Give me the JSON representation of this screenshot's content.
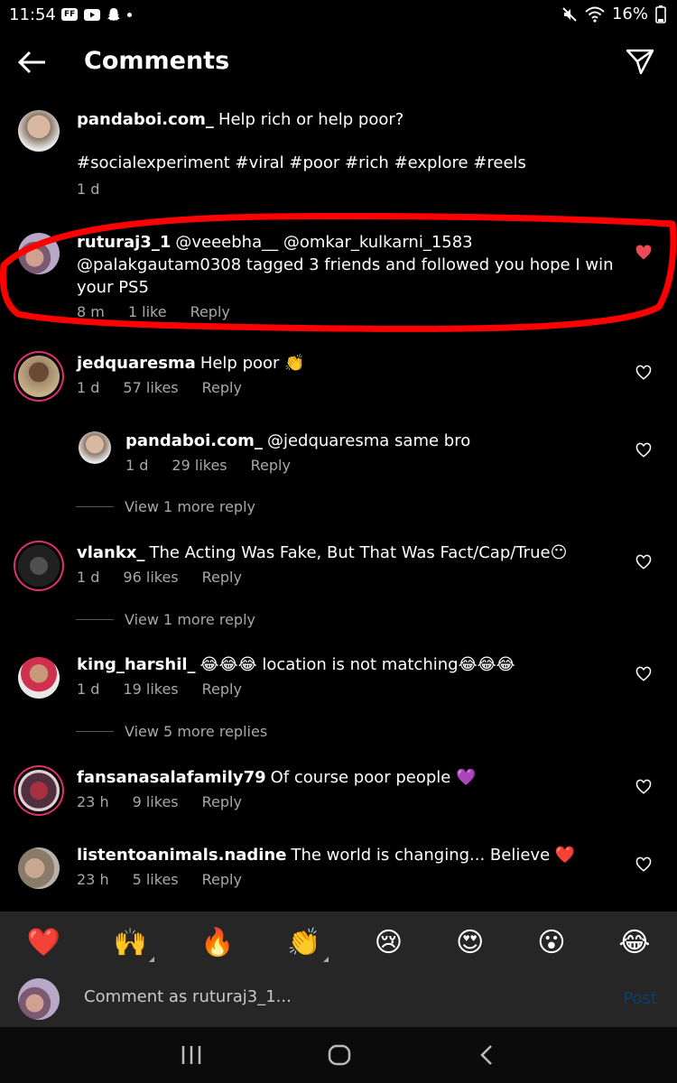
{
  "status_bar": {
    "time": "11:54",
    "battery": "16%",
    "carrier_badge": "FF"
  },
  "header": {
    "title": "Comments"
  },
  "post": {
    "username": "pandaboi.com_",
    "text": "Help rich or help poor?",
    "hashtags": "#socialexperiment #viral #poor #rich #explore #reels",
    "time": "1 d"
  },
  "comments": [
    {
      "username": "ruturaj3_1",
      "text": "@veeebha__ @omkar_kulkarni_1583 @palakgautam0308 tagged 3 friends and followed you hope I win your PS5",
      "time": "8 m",
      "likes": "1 like",
      "reply": "Reply",
      "liked": true
    },
    {
      "username": "jedquaresma",
      "text": "Help poor 👏",
      "time": "1 d",
      "likes": "57 likes",
      "reply": "Reply"
    },
    {
      "username": "pandaboi.com_",
      "text": "@jedquaresma same bro",
      "time": "1 d",
      "likes": "29 likes",
      "reply": "Reply"
    },
    {
      "username": "vlankx_",
      "text": "The Acting Was Fake, But That Was Fact/Cap/True😶",
      "time": "1 d",
      "likes": "96 likes",
      "reply": "Reply"
    },
    {
      "username": "king_harshil_",
      "text": "😂😂😂 location is not matching😂😂😂",
      "time": "1 d",
      "likes": "19 likes",
      "reply": "Reply"
    },
    {
      "username": "fansanasalafamily79",
      "text": "Of course poor people 💜",
      "time": "23 h",
      "likes": "9 likes",
      "reply": "Reply"
    },
    {
      "username": "listentoanimals.nadine",
      "text": "The world is changing... Believe ❤️",
      "time": "23 h",
      "likes": "5 likes",
      "reply": "Reply"
    }
  ],
  "view_more": [
    "View 1 more reply",
    "View 1 more reply",
    "View 5 more replies"
  ],
  "emoji_bar": [
    "❤️",
    "🙌",
    "🔥",
    "👏",
    "😢",
    "😍",
    "😮",
    "😂"
  ],
  "composer": {
    "placeholder": "Comment as ruturaj3_1...",
    "post_label": "Post"
  },
  "colors": {
    "background": "#000000",
    "muted_text": "#a8a8a8",
    "like_red": "#ed4956",
    "highlight_red": "#ff0000",
    "post_disabled": "#0a3f6a"
  }
}
